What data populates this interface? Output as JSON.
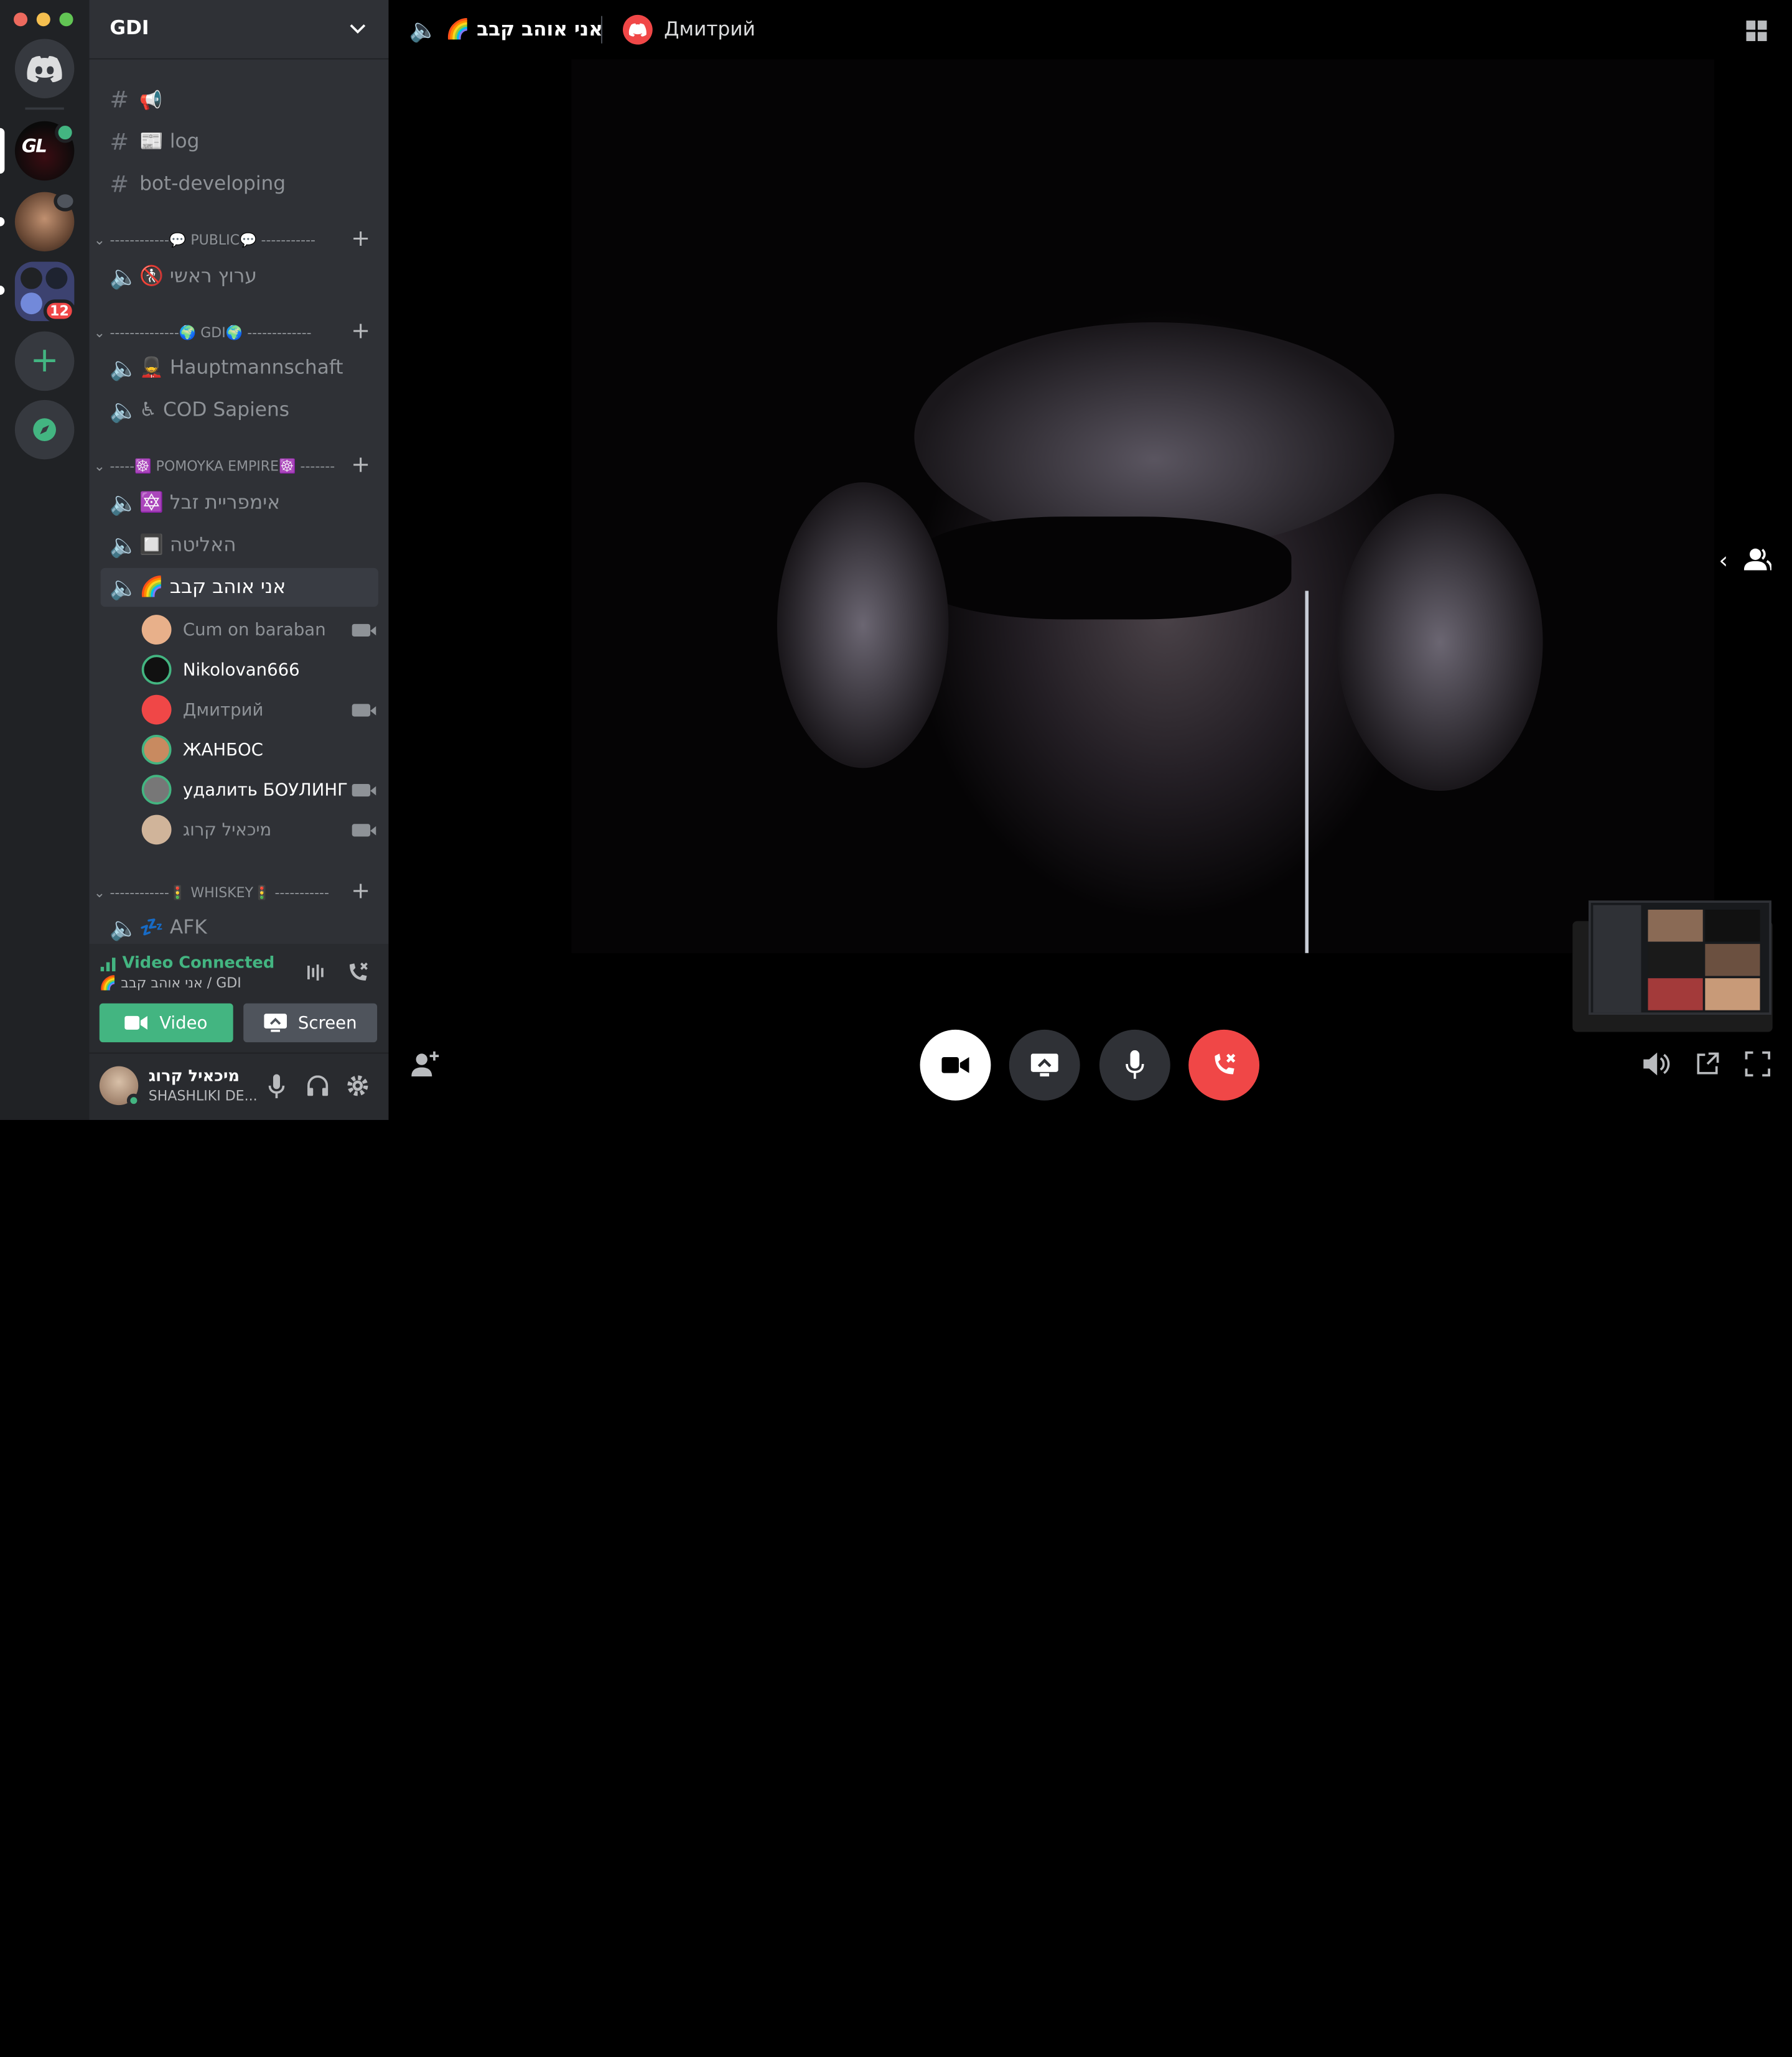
{
  "window": {
    "traffic_lights": [
      "#ed6a5e",
      "#f5bf4f",
      "#62c554"
    ]
  },
  "server_rail": {
    "notification_badge": "12"
  },
  "guild": {
    "name": "GDI"
  },
  "text_channels": [
    {
      "icon": "megaphone-icon",
      "name": ""
    },
    {
      "icon": "newspaper-icon",
      "name": "📰 log"
    },
    {
      "icon": "hash-icon",
      "name": "bot-developing"
    }
  ],
  "categories": {
    "public": "------------💬 PUBLIC💬 -----------",
    "gdi": "--------------🌍 GDI🌍 -------------",
    "pomoyka": "-----☸️ POMOYKA EMPIRE☸️ -------",
    "whiskey": "------------🚦 WHISKEY🚦 -----------"
  },
  "voice_channels": {
    "public_1": "🚷 ערוץ ראשי",
    "gdi_1": "💂 Hauptmannschaft",
    "gdi_2": "♿ COD Sapiens",
    "pomoyka_1": "🔯 אימפריית זבל",
    "pomoyka_2": "🔲 האליטה",
    "pomoyka_3": "🌈 אני אוהב קבב",
    "whiskey_1": "💤 AFK"
  },
  "members": [
    {
      "name": "Cum on baraban",
      "video": true,
      "muted": true
    },
    {
      "name": "Nikolovan666",
      "video": false,
      "muted": false
    },
    {
      "name": "Дмитрий",
      "video": true,
      "muted": true
    },
    {
      "name": "ЖАНБОС",
      "video": false,
      "muted": false
    },
    {
      "name": "удалить БОУЛИНГ",
      "video": true,
      "muted": false
    },
    {
      "name": "מיכאיל קרוג",
      "video": true,
      "muted": true
    }
  ],
  "voice_panel": {
    "status": "Video Connected",
    "location": "🌈 אני אוהב קבב / GDI",
    "video_button": "Video",
    "screen_button": "Screen"
  },
  "user_panel": {
    "username": "מיכאיל קרוג",
    "status": "SHASHLIKI DE..."
  },
  "call_header": {
    "channel_name": "🌈 אני אוהב קבב",
    "speaker_name": "Дмитрий"
  },
  "colors": {
    "accent_green": "#43b581",
    "danger_red": "#f04747",
    "blurple": "#7289da",
    "sidebar": "#2f3136",
    "rail": "#202225"
  }
}
